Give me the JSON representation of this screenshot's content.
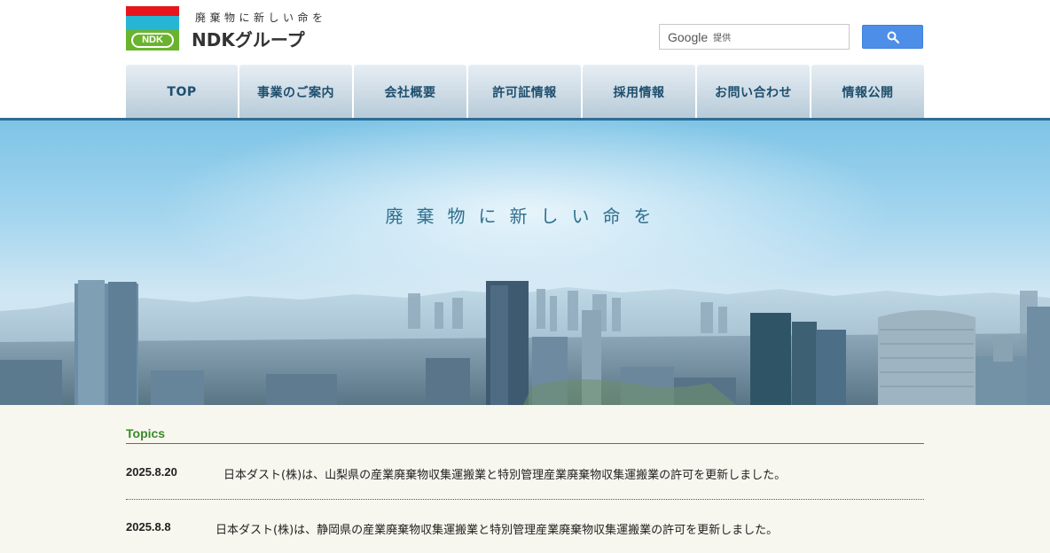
{
  "header": {
    "tagline": "廃棄物に新しい命を",
    "brand": "NDKグループ",
    "logo_badge": "NDK",
    "search": {
      "brand": "Google",
      "provided": "提供",
      "button_icon": "search-icon"
    }
  },
  "nav": {
    "items": [
      {
        "label": "TOP"
      },
      {
        "label": "事業のご案内"
      },
      {
        "label": "会社概要"
      },
      {
        "label": "許可証情報"
      },
      {
        "label": "採用情報"
      },
      {
        "label": "お問い合わせ"
      },
      {
        "label": "情報公開"
      }
    ]
  },
  "hero": {
    "headline": "廃棄物に新しい命を"
  },
  "topics": {
    "title": "Topics",
    "items": [
      {
        "date": "2025.8.20",
        "text": "日本ダスト(株)は、山梨県の産業廃棄物収集運搬業と特別管理産業廃棄物収集運搬業の許可を更新しました。"
      },
      {
        "date": "2025.8.8",
        "text": "日本ダスト(株)は、静岡県の産業廃棄物収集運搬業と特別管理産業廃棄物収集運搬業の許可を更新しました。"
      }
    ]
  },
  "colors": {
    "logo_red": "#e8141b",
    "logo_cyan": "#27b5d6",
    "logo_green": "#6ab42d",
    "nav_text": "#1e4f6e",
    "nav_rule": "#2d6c94",
    "topics_accent": "#3b8a2a",
    "search_button": "#4d8ee8"
  }
}
